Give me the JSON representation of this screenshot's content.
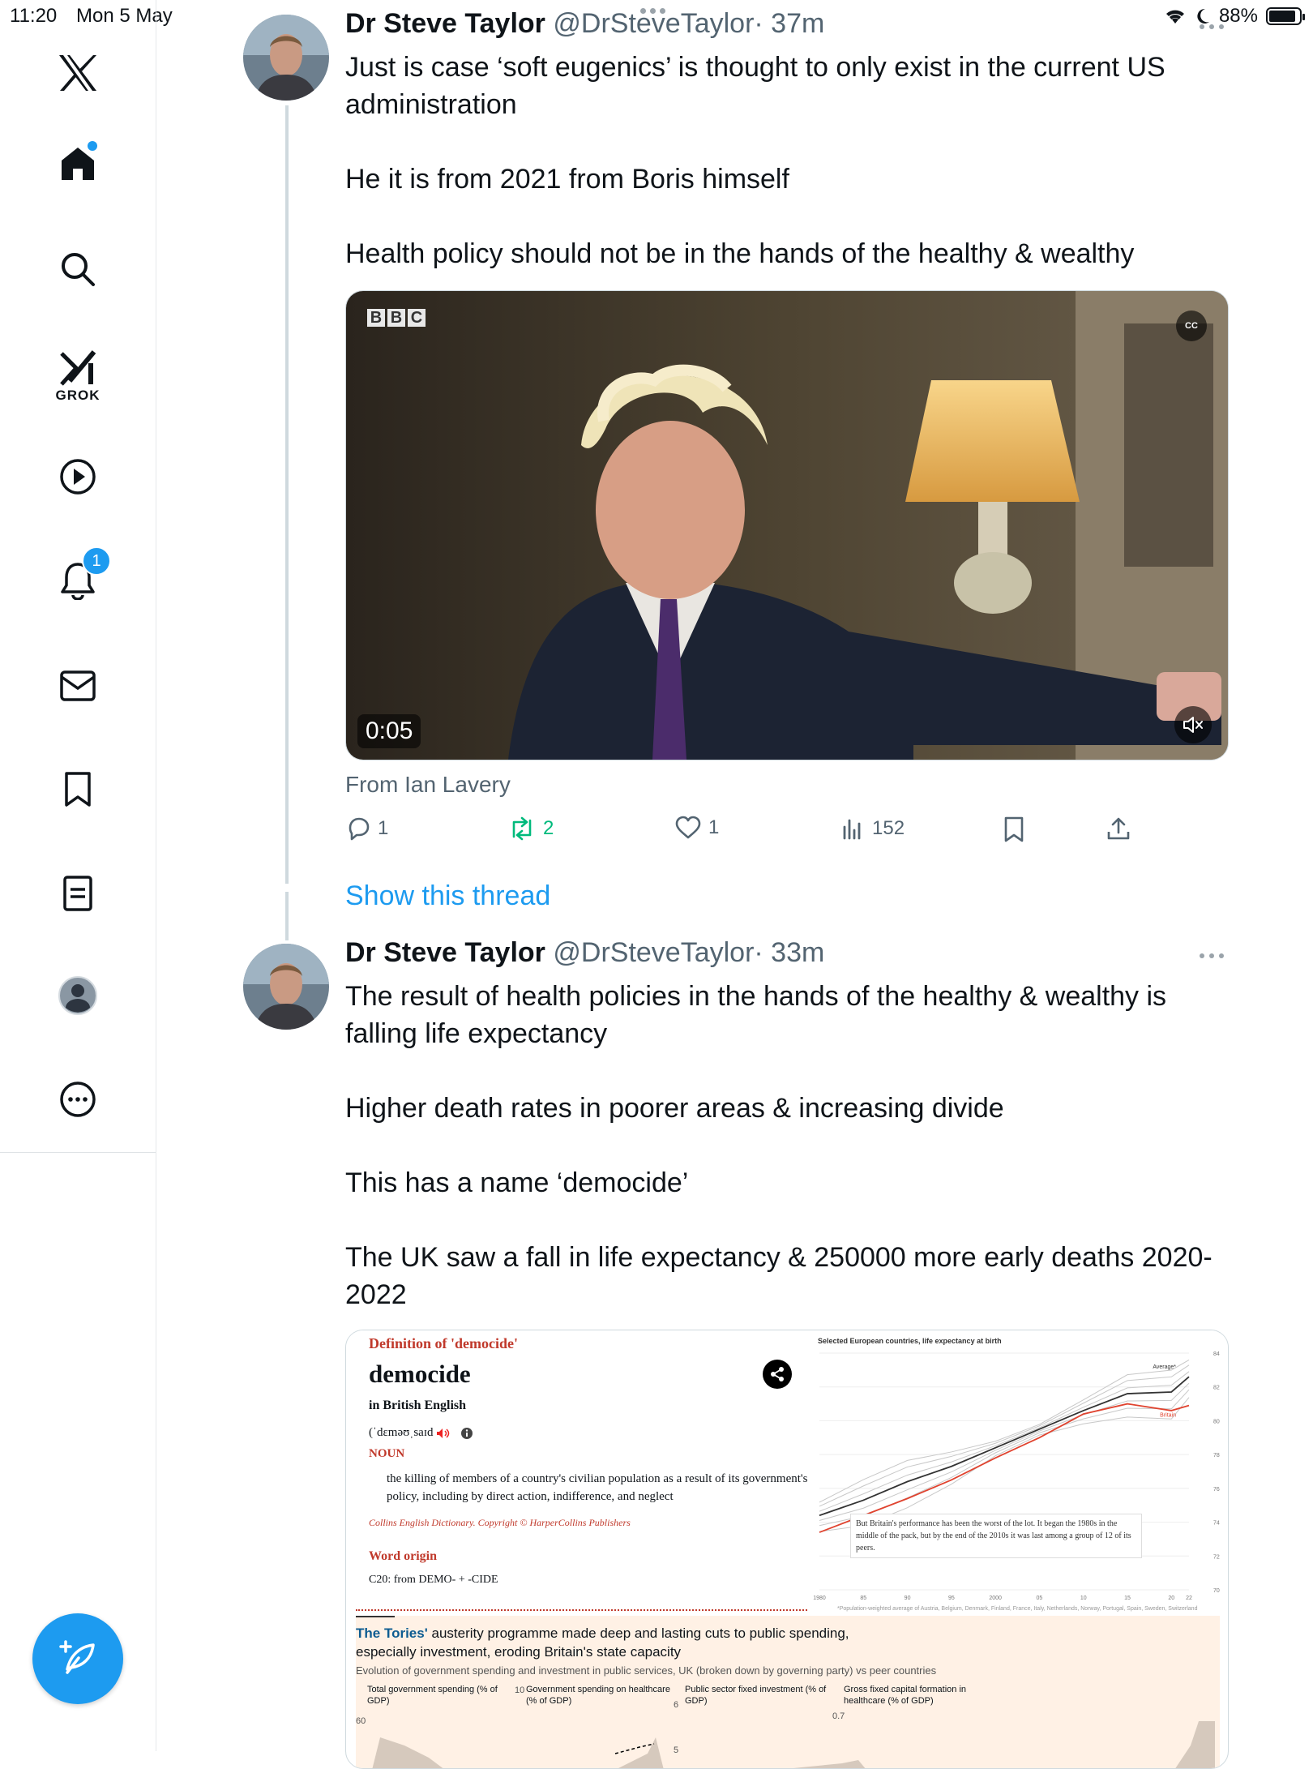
{
  "status_bar": {
    "time": "11:20",
    "date": "Mon 5 May",
    "battery": "88%"
  },
  "sidebar": {
    "grok_label": "GROK",
    "notification_count": "1"
  },
  "tweet1": {
    "name": "Dr Steve Taylor",
    "handle": "@DrSteveTaylor",
    "age": "· 37m",
    "text": [
      "Just is case ‘soft eugenics’ is thought to only exist in the current US administration",
      "He it is from 2021 from Boris himself",
      "Health policy should not be in the hands of the healthy & wealthy"
    ],
    "video": {
      "duration": "0:05",
      "watermark": [
        "B",
        "B",
        "C"
      ],
      "cc": "CC"
    },
    "from": "From Ian Lavery",
    "actions": {
      "replies": "1",
      "reposts": "2",
      "likes": "1",
      "views": "152"
    },
    "show_thread": "Show this thread"
  },
  "tweet2": {
    "name": "Dr Steve Taylor",
    "handle": "@DrSteveTaylor",
    "age": "· 33m",
    "text": [
      "The result of health policies in the hands of the healthy & wealthy is falling life expectancy",
      "Higher death rates in poorer areas & increasing divide",
      "This has a name ‘democide’",
      "The UK saw a fall in life expectancy & 250000 more early deaths 2020-2022"
    ],
    "image": {
      "dictionary": {
        "title": "Definition of 'democide'",
        "word": "democide",
        "language": "in British English",
        "pronunciation": "(ˈdɛməʊˌsaɪd",
        "part_of_speech": "NOUN",
        "definition": "the killing of members of a country's civilian population as a result of its government's policy, including by direct action, indifference, and neglect",
        "copyright": "Collins English Dictionary. Copyright © HarperCollins Publishers",
        "origin_heading": "Word origin",
        "origin": "C20: from DEMO- + -CIDE"
      },
      "chart_title": "Selected European countries, life expectancy at birth",
      "chart_annotation": "But Britain's performance has been the worst of the lot. It began the 1980s in the middle of the pack, but by the end of the 2010s it was last among a group of 12 of its peers.",
      "chart_footnote": "*Population-weighted average of Austria, Belgium, Denmark, Finland, France, Italy, Netherlands, Norway, Portugal, Spain, Sweden, Switzerland",
      "ft_heading_blue": "The Tories'",
      "ft_heading_rest": "austerity programme made deep and lasting cuts to public spending, especially investment, eroding Britain's state capacity",
      "ft_sub": "Evolution of government spending and investment in public services, UK (broken down by governing party) vs peer countries",
      "ft_columns": [
        "Total government spending (% of GDP)",
        "Government spending on healthcare (% of GDP)",
        "Public sector fixed investment (% of GDP)",
        "Gross fixed capital formation in healthcare (% of GDP)"
      ],
      "ft_ticks": [
        "60",
        "10",
        "6",
        "5",
        "0.7"
      ]
    }
  },
  "chart_data": {
    "type": "line",
    "title": "Selected European countries, life expectancy at birth",
    "x": [
      1980,
      1985,
      1990,
      1995,
      2000,
      2005,
      2010,
      2015,
      2020,
      2022
    ],
    "x_tick_labels": [
      "1980",
      "85",
      "90",
      "95",
      "2000",
      "05",
      "10",
      "15",
      "20",
      "22"
    ],
    "y_tick_labels": [
      "70",
      "72",
      "74",
      "76",
      "78",
      "80",
      "82",
      "84"
    ],
    "ylim": [
      70,
      84
    ],
    "series": [
      {
        "name": "Average*",
        "values": [
          74.4,
          75.3,
          76.4,
          77.3,
          78.4,
          79.5,
          80.6,
          81.6,
          81.7,
          82.6
        ]
      },
      {
        "name": "Britain",
        "values": [
          73.4,
          74.4,
          75.4,
          76.5,
          77.8,
          79.0,
          80.4,
          81.0,
          80.6,
          80.9
        ]
      }
    ],
    "colors": {
      "Average*": "#333333",
      "Britain": "#e0432f",
      "peers": "#c8c8c8"
    }
  }
}
